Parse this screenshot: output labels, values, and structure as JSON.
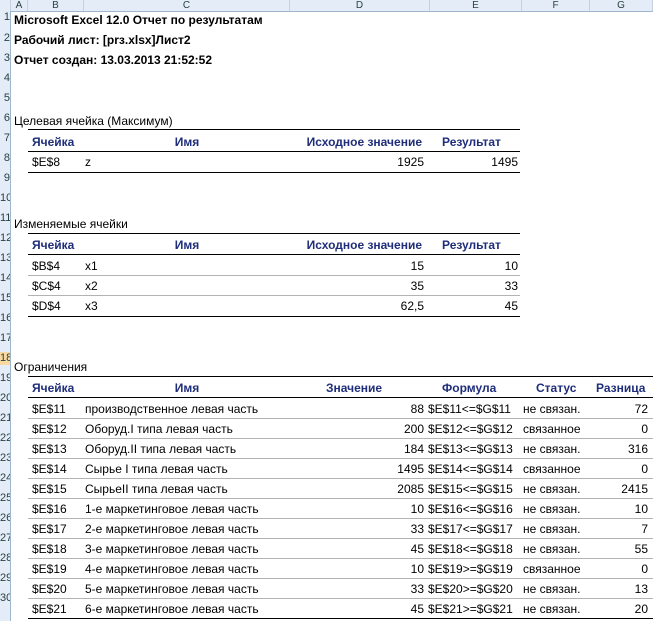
{
  "col_headers": [
    "A",
    "B",
    "C",
    "D",
    "E",
    "F",
    "G"
  ],
  "row_headers": [
    "1",
    "2",
    "3",
    "4",
    "5",
    "6",
    "7",
    "8",
    "9",
    "10",
    "11",
    "12",
    "13",
    "14",
    "15",
    "16",
    "17",
    "18",
    "19",
    "20",
    "21",
    "22",
    "23",
    "24",
    "25",
    "26",
    "27",
    "28",
    "29",
    "30"
  ],
  "report": {
    "title": "Microsoft Excel 12.0 Отчет по результатам",
    "sheet": "Рабочий лист: [prз.xlsx]Лист2",
    "created": "Отчет создан: 13.03.2013 21:52:52"
  },
  "target": {
    "section": "Целевая ячейка (Максимум)",
    "headers": [
      "Ячейка",
      "Имя",
      "Исходное значение",
      "Результат"
    ],
    "row": {
      "cell": "$E$8",
      "name": "z",
      "orig": "1925",
      "result": "1495"
    }
  },
  "variables": {
    "section": "Изменяемые ячейки",
    "headers": [
      "Ячейка",
      "Имя",
      "Исходное значение",
      "Результат"
    ],
    "rows": [
      {
        "cell": "$B$4",
        "name": "x1",
        "orig": "15",
        "result": "10"
      },
      {
        "cell": "$C$4",
        "name": "x2",
        "orig": "35",
        "result": "33"
      },
      {
        "cell": "$D$4",
        "name": "x3",
        "orig": "62,5",
        "result": "45"
      }
    ]
  },
  "constraints": {
    "section": "Ограничения",
    "headers": [
      "Ячейка",
      "Имя",
      "Значение",
      "Формула",
      "Статус",
      "Разница"
    ],
    "rows": [
      {
        "cell": "$E$11",
        "name": "производственное левая часть",
        "value": "88",
        "formula": "$E$11<=$G$11",
        "status": "не связан.",
        "diff": "72"
      },
      {
        "cell": "$E$12",
        "name": "Оборуд.I типа левая часть",
        "value": "200",
        "formula": "$E$12<=$G$12",
        "status": "связанное",
        "diff": "0"
      },
      {
        "cell": "$E$13",
        "name": "Оборуд.II типа левая часть",
        "value": "184",
        "formula": "$E$13<=$G$13",
        "status": "не связан.",
        "diff": "316"
      },
      {
        "cell": "$E$14",
        "name": "Сырье I типа левая часть",
        "value": "1495",
        "formula": "$E$14<=$G$14",
        "status": "связанное",
        "diff": "0"
      },
      {
        "cell": "$E$15",
        "name": "СырьеII типа левая часть",
        "value": "2085",
        "formula": "$E$15<=$G$15",
        "status": "не связан.",
        "diff": "2415"
      },
      {
        "cell": "$E$16",
        "name": "1-е маркетинговое левая часть",
        "value": "10",
        "formula": "$E$16<=$G$16",
        "status": "не связан.",
        "diff": "10"
      },
      {
        "cell": "$E$17",
        "name": "2-е маркетинговое левая часть",
        "value": "33",
        "formula": "$E$17<=$G$17",
        "status": "не связан.",
        "diff": "7"
      },
      {
        "cell": "$E$18",
        "name": "3-е маркетинговое левая часть",
        "value": "45",
        "formula": "$E$18<=$G$18",
        "status": "не связан.",
        "diff": "55"
      },
      {
        "cell": "$E$19",
        "name": "4-е маркетинговое левая часть",
        "value": "10",
        "formula": "$E$19>=$G$19",
        "status": "связанное",
        "diff": "0"
      },
      {
        "cell": "$E$20",
        "name": "5-е маркетинговое левая часть",
        "value": "33",
        "formula": "$E$20>=$G$20",
        "status": "не связан.",
        "diff": "13"
      },
      {
        "cell": "$E$21",
        "name": "6-е маркетинговое левая часть",
        "value": "45",
        "formula": "$E$21>=$G$21",
        "status": "не связан.",
        "diff": "20"
      }
    ]
  }
}
